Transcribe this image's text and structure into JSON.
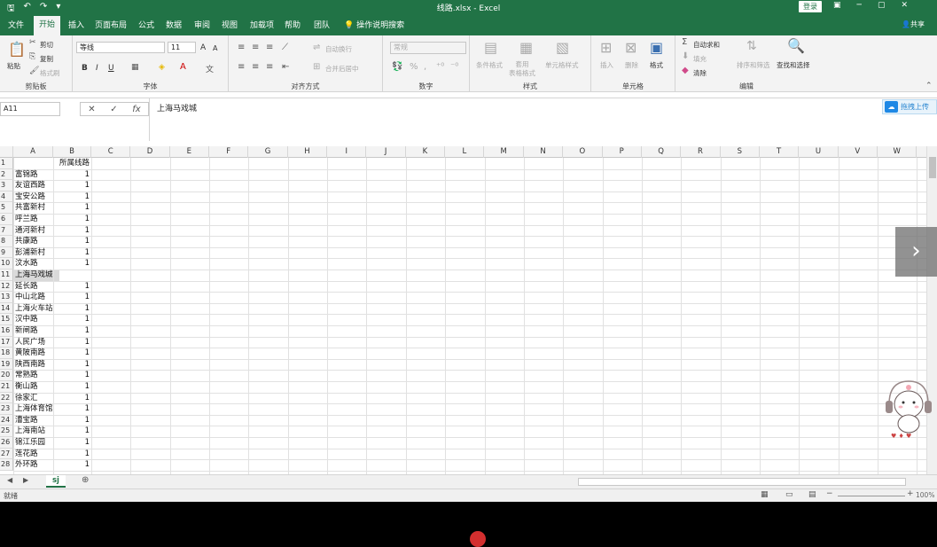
{
  "window": {
    "title": "线路.xlsx - Excel",
    "login_label": "登录",
    "minimize": "─",
    "restore": "▢",
    "close": "✕",
    "ribbon_display": "▣"
  },
  "tabs": [
    "文件",
    "开始",
    "插入",
    "页面布局",
    "公式",
    "数据",
    "审阅",
    "视图",
    "加载项",
    "帮助",
    "团队"
  ],
  "active_tab": "开始",
  "tell_me": "操作说明搜索",
  "share": "共享",
  "ribbon": {
    "clipboard": {
      "paste": "粘贴",
      "cut": "剪切",
      "copy": "复制",
      "format_painter": "格式刷",
      "label": "剪贴板"
    },
    "font": {
      "name": "等线",
      "size": "11",
      "grow": "A",
      "shrink": "A",
      "bold": "B",
      "italic": "I",
      "underline": "U",
      "label": "字体"
    },
    "alignment": {
      "wrap": "自动换行",
      "merge": "合并后居中",
      "label": "对齐方式"
    },
    "number": {
      "format": "常规",
      "label": "数字"
    },
    "styles": {
      "conditional": "条件格式",
      "as_table": "套用\n表格格式",
      "cell_styles": "单元格样式",
      "label": "样式"
    },
    "cells": {
      "insert": "插入",
      "delete": "删除",
      "format": "格式",
      "label": "单元格"
    },
    "editing": {
      "autosum": "自动求和",
      "fill": "填充",
      "clear": "清除",
      "sort": "排序和筛选",
      "find": "查找和选择",
      "label": "编辑"
    }
  },
  "formula_bar": {
    "name_box": "A11",
    "formula": "上海马戏城",
    "cloud_label": "拖拽上传"
  },
  "columns": [
    "A",
    "B",
    "C",
    "D",
    "E",
    "F",
    "G",
    "H",
    "I",
    "J",
    "K",
    "L",
    "M",
    "N",
    "O",
    "P",
    "Q",
    "R",
    "S",
    "T",
    "U",
    "V",
    "W"
  ],
  "rows": [
    {
      "n": "1",
      "a": "",
      "b": "所属线路"
    },
    {
      "n": "2",
      "a": "富锦路",
      "b": "1"
    },
    {
      "n": "3",
      "a": "友谊西路",
      "b": "1"
    },
    {
      "n": "4",
      "a": "宝安公路",
      "b": "1"
    },
    {
      "n": "5",
      "a": "共富新村",
      "b": "1"
    },
    {
      "n": "6",
      "a": "呼兰路",
      "b": "1"
    },
    {
      "n": "7",
      "a": "通河新村",
      "b": "1"
    },
    {
      "n": "8",
      "a": "共康路",
      "b": "1"
    },
    {
      "n": "9",
      "a": "彭浦新村",
      "b": "1"
    },
    {
      "n": "10",
      "a": "汶水路",
      "b": "1"
    },
    {
      "n": "11",
      "a": "上海马戏城",
      "b": ""
    },
    {
      "n": "12",
      "a": "延长路",
      "b": "1"
    },
    {
      "n": "13",
      "a": "中山北路",
      "b": "1"
    },
    {
      "n": "14",
      "a": "上海火车站",
      "b": "1"
    },
    {
      "n": "15",
      "a": "汉中路",
      "b": "1"
    },
    {
      "n": "16",
      "a": "新闸路",
      "b": "1"
    },
    {
      "n": "17",
      "a": "人民广场",
      "b": "1"
    },
    {
      "n": "18",
      "a": "黄陂南路",
      "b": "1"
    },
    {
      "n": "19",
      "a": "陕西南路",
      "b": "1"
    },
    {
      "n": "20",
      "a": "常熟路",
      "b": "1"
    },
    {
      "n": "21",
      "a": "衡山路",
      "b": "1"
    },
    {
      "n": "22",
      "a": "徐家汇",
      "b": "1"
    },
    {
      "n": "23",
      "a": "上海体育馆",
      "b": "1"
    },
    {
      "n": "24",
      "a": "漕宝路",
      "b": "1"
    },
    {
      "n": "25",
      "a": "上海南站",
      "b": "1"
    },
    {
      "n": "26",
      "a": "锦江乐园",
      "b": "1"
    },
    {
      "n": "27",
      "a": "莲花路",
      "b": "1"
    },
    {
      "n": "28",
      "a": "外环路",
      "b": "1"
    }
  ],
  "sheet_tab": "sj",
  "status": {
    "ready": "就绪",
    "zoom": "100%"
  },
  "overlay": {
    "next": "›"
  },
  "colors": {
    "excel_green": "#217346",
    "ribbon_bg": "#f3f3f3",
    "selection": "#d9d9d9"
  }
}
